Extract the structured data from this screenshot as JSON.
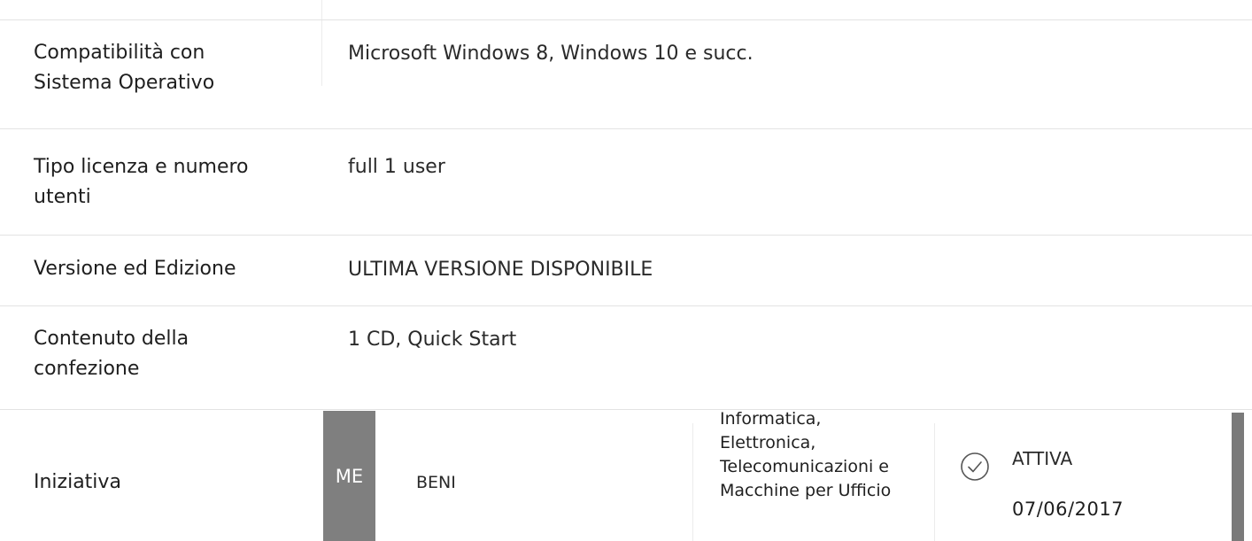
{
  "specs": [
    {
      "label": "Compatibilità con Sistema Operativo",
      "value": "Microsoft Windows 8, Windows 10 e succ."
    },
    {
      "label": "Tipo licenza e numero utenti",
      "value": "full 1 user"
    },
    {
      "label": "Versione ed Edizione",
      "value": "ULTIMA VERSIONE DISPONIBILE"
    },
    {
      "label": "Contenuto della confezione",
      "value": "1 CD, Quick Start"
    }
  ],
  "iniziativa": {
    "label": "Iniziativa",
    "badge": "ME",
    "type": "BENI",
    "category": "Informatica, Elettronica, Telecomunicazioni e Macchine per Ufficio",
    "status": "ATTIVA",
    "date": "07/06/2017",
    "status_icon": "check-circle-icon"
  }
}
